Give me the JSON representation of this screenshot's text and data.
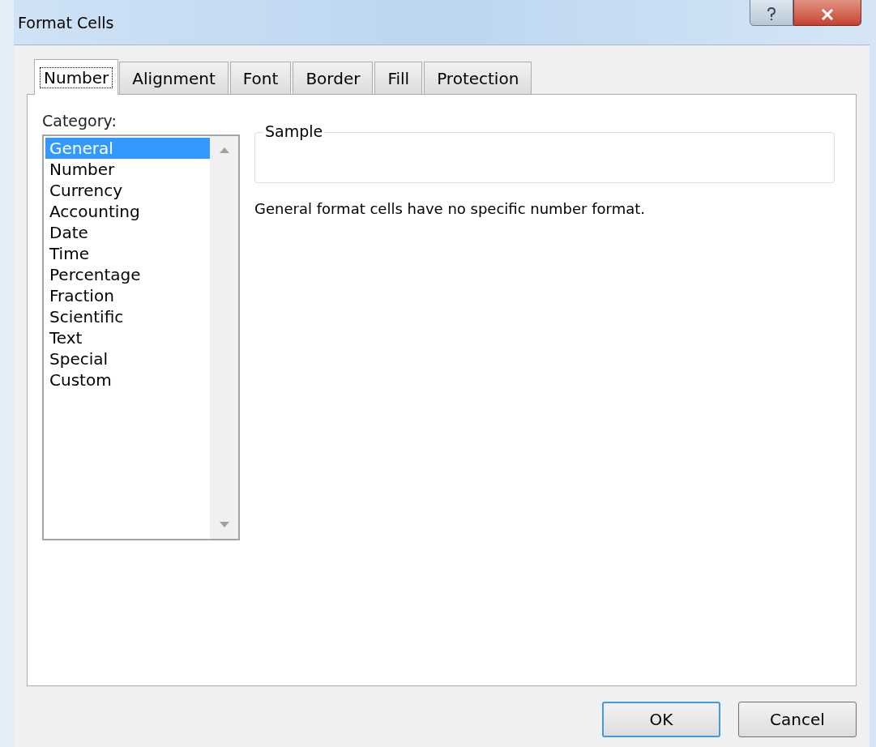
{
  "window": {
    "title": "Format Cells"
  },
  "tabs": [
    {
      "label": "Number",
      "selected": true
    },
    {
      "label": "Alignment",
      "selected": false
    },
    {
      "label": "Font",
      "selected": false
    },
    {
      "label": "Border",
      "selected": false
    },
    {
      "label": "Fill",
      "selected": false
    },
    {
      "label": "Protection",
      "selected": false
    }
  ],
  "category": {
    "label": "Category:",
    "items": [
      {
        "label": "General",
        "selected": true
      },
      {
        "label": "Number",
        "selected": false
      },
      {
        "label": "Currency",
        "selected": false
      },
      {
        "label": "Accounting",
        "selected": false
      },
      {
        "label": "Date",
        "selected": false
      },
      {
        "label": "Time",
        "selected": false
      },
      {
        "label": "Percentage",
        "selected": false
      },
      {
        "label": "Fraction",
        "selected": false
      },
      {
        "label": "Scientific",
        "selected": false
      },
      {
        "label": "Text",
        "selected": false
      },
      {
        "label": "Special",
        "selected": false
      },
      {
        "label": "Custom",
        "selected": false
      }
    ]
  },
  "sample": {
    "label": "Sample"
  },
  "description": "General format cells have no specific number format.",
  "buttons": [
    {
      "label": "OK",
      "default": true
    },
    {
      "label": "Cancel",
      "default": false
    }
  ]
}
